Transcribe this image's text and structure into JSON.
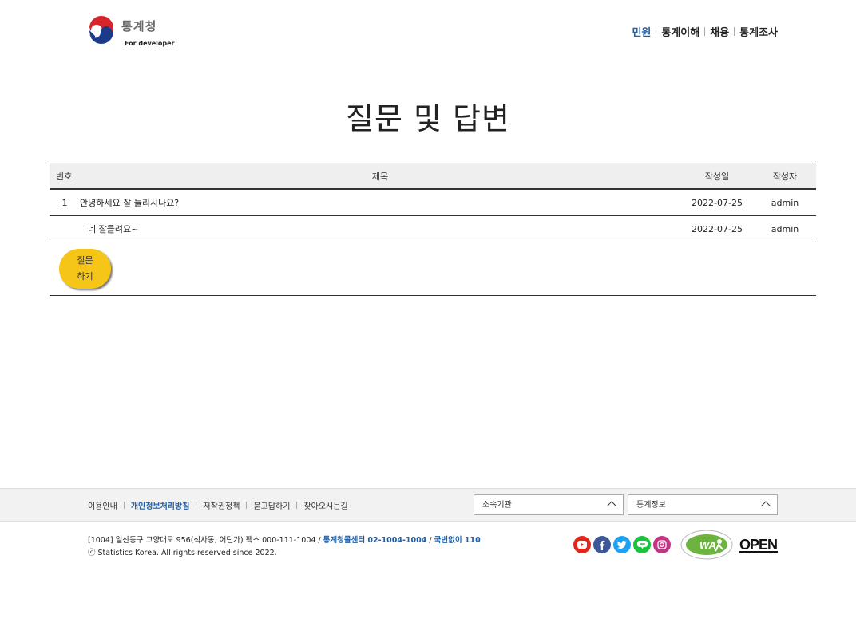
{
  "header": {
    "logo_name": "통계청",
    "logo_sub": "For developer",
    "nav": [
      {
        "label": "민원",
        "active": true
      },
      {
        "label": "통계이해",
        "active": false
      },
      {
        "label": "채용",
        "active": false
      },
      {
        "label": "통계조사",
        "active": false
      }
    ]
  },
  "page_title": "질문 및 답변",
  "board": {
    "columns": {
      "no": "번호",
      "title": "제목",
      "date": "작성일",
      "writer": "작성자"
    },
    "rows": [
      {
        "no": "1",
        "title": "안녕하세요 잘 들리시나요?",
        "date": "2022-07-25",
        "writer": "admin"
      },
      {
        "no": "",
        "title": "네 잘들려요~",
        "date": "2022-07-25",
        "writer": "admin"
      }
    ],
    "ask_button_line1": "질문",
    "ask_button_line2": "하기"
  },
  "footer": {
    "links": [
      {
        "label": "이용안내",
        "strong": false
      },
      {
        "label": "개인정보처리방침",
        "strong": true
      },
      {
        "label": "저작권정책",
        "strong": false
      },
      {
        "label": "묻고답하기",
        "strong": false
      },
      {
        "label": "찾아오시는길",
        "strong": false
      }
    ],
    "dropdown1": "소속기관",
    "dropdown2": "통계정보",
    "address_plain": "[1004] 일산동구 고양대로 956(식사동, 어딘가) 팩스 000-111-1004 / ",
    "callcenter": "통계청콜센터 02-1004-1004",
    "slash": " / ",
    "phone": "국번없이 110",
    "copyright": "ⓒ Statistics Korea. All rights reserved since 2022.",
    "sns": [
      {
        "icon": "youtube-icon",
        "color": "#e1251b"
      },
      {
        "icon": "facebook-icon",
        "color": "#3b5998"
      },
      {
        "icon": "twitter-icon",
        "color": "#1da1f2"
      },
      {
        "icon": "blog-icon",
        "color": "#19c33d"
      },
      {
        "icon": "instagram-icon",
        "color": "#c13584"
      }
    ],
    "wa_mark": "WA",
    "open_mark": "OPEN"
  },
  "colors": {
    "accent": "#1f5fa8",
    "button": "#f5c518"
  }
}
